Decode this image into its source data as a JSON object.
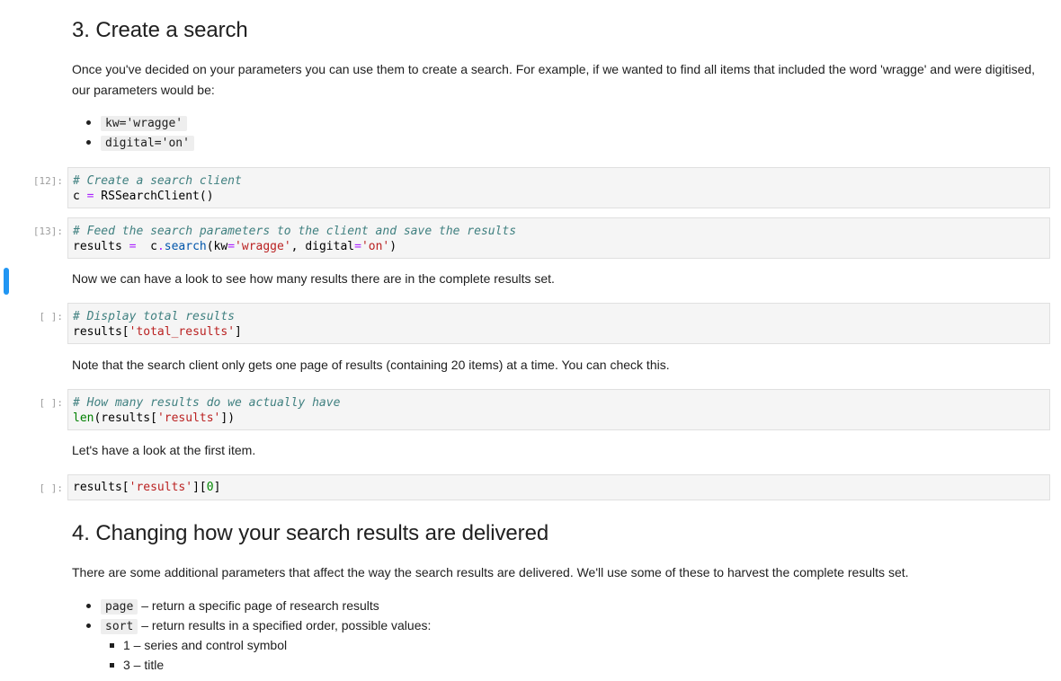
{
  "section3": {
    "heading": "3. Create a search",
    "intro": "Once you've decided on your parameters you can use them to create a search. For example, if we wanted to find all items that included the word 'wragge' and were digitised, our parameters would be:",
    "params": [
      "kw='wragge'",
      "digital='on'"
    ]
  },
  "cells": [
    {
      "prompt": "[12]:",
      "line1_comment": "# Create a search client",
      "line2": "c = RSSearchClient()"
    },
    {
      "prompt": "[13]:",
      "line1_comment": "# Feed the search parameters to the client and save the results",
      "line2": "results =  c.search(kw='wragge', digital='on')"
    },
    {
      "prompt": "[ ]:",
      "line1_comment": "# Display total results",
      "line2": "results['total_results']"
    },
    {
      "prompt": "[ ]:",
      "line1_comment": "# How many results do we actually have",
      "line2": "len(results['results'])"
    },
    {
      "prompt": "[ ]:",
      "line1": "results['results'][0]"
    }
  ],
  "texts": {
    "after_cell2": "Now we can have a look to see how many results there are in the complete results set.",
    "after_cell3": "Note that the search client only gets one page of results (containing 20 items) at a time. You can check this.",
    "after_cell4": "Let's have a look at the first item."
  },
  "section4": {
    "heading": "4. Changing how your search results are delivered",
    "intro": "There are some additional parameters that affect the way the search results are delivered. We'll use some of these to harvest the complete results set.",
    "page_code": "page",
    "page_desc": " – return a specific page of research results",
    "sort_code": "sort",
    "sort_desc": " – return results in a specified order, possible values:",
    "sort_values": [
      "1 – series and control symbol",
      "3 – title"
    ]
  },
  "colors": {
    "selected_cell_bar": "#2196f3",
    "code_bg": "#f5f5f5",
    "comment": "#408080",
    "string": "#ba2121",
    "builtin": "#008000",
    "operator": "#aa22ff"
  }
}
